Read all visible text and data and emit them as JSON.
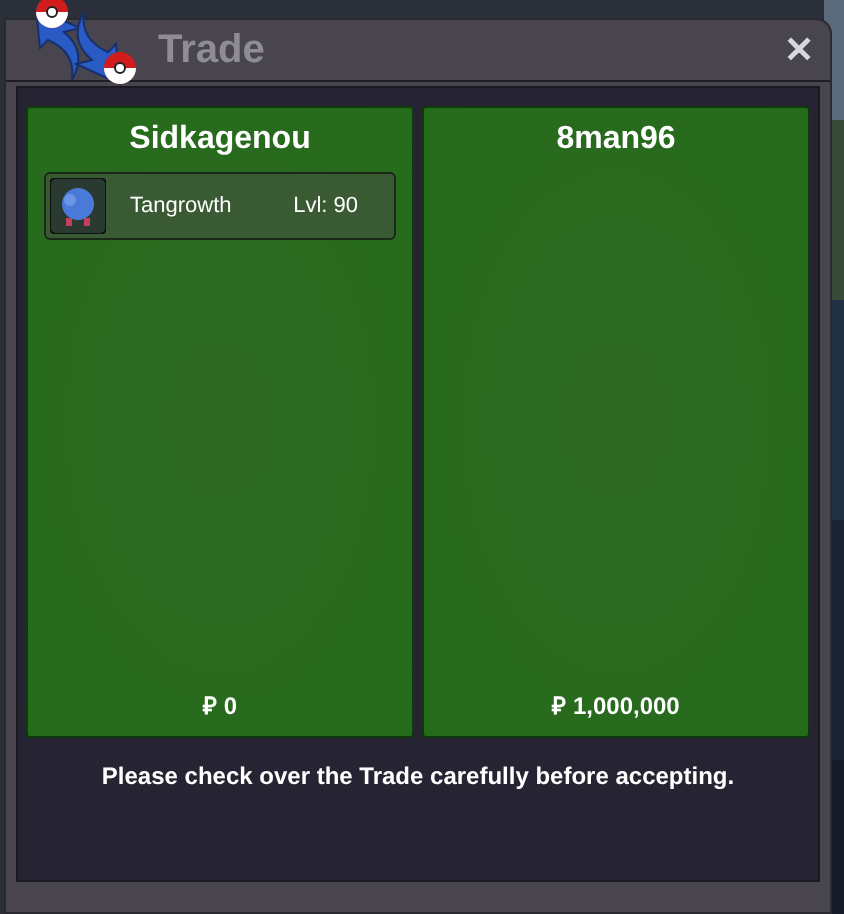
{
  "window": {
    "title": "Trade",
    "close": "✕"
  },
  "offers": [
    {
      "player": "Sidkagenou",
      "items": [
        {
          "name": "Tangrowth",
          "level": "Lvl: 90"
        }
      ],
      "money": "₽ 0"
    },
    {
      "player": "8man96",
      "money": "₽ 1,000,000"
    }
  ],
  "notice": "Please check over the Trade carefully before accepting."
}
